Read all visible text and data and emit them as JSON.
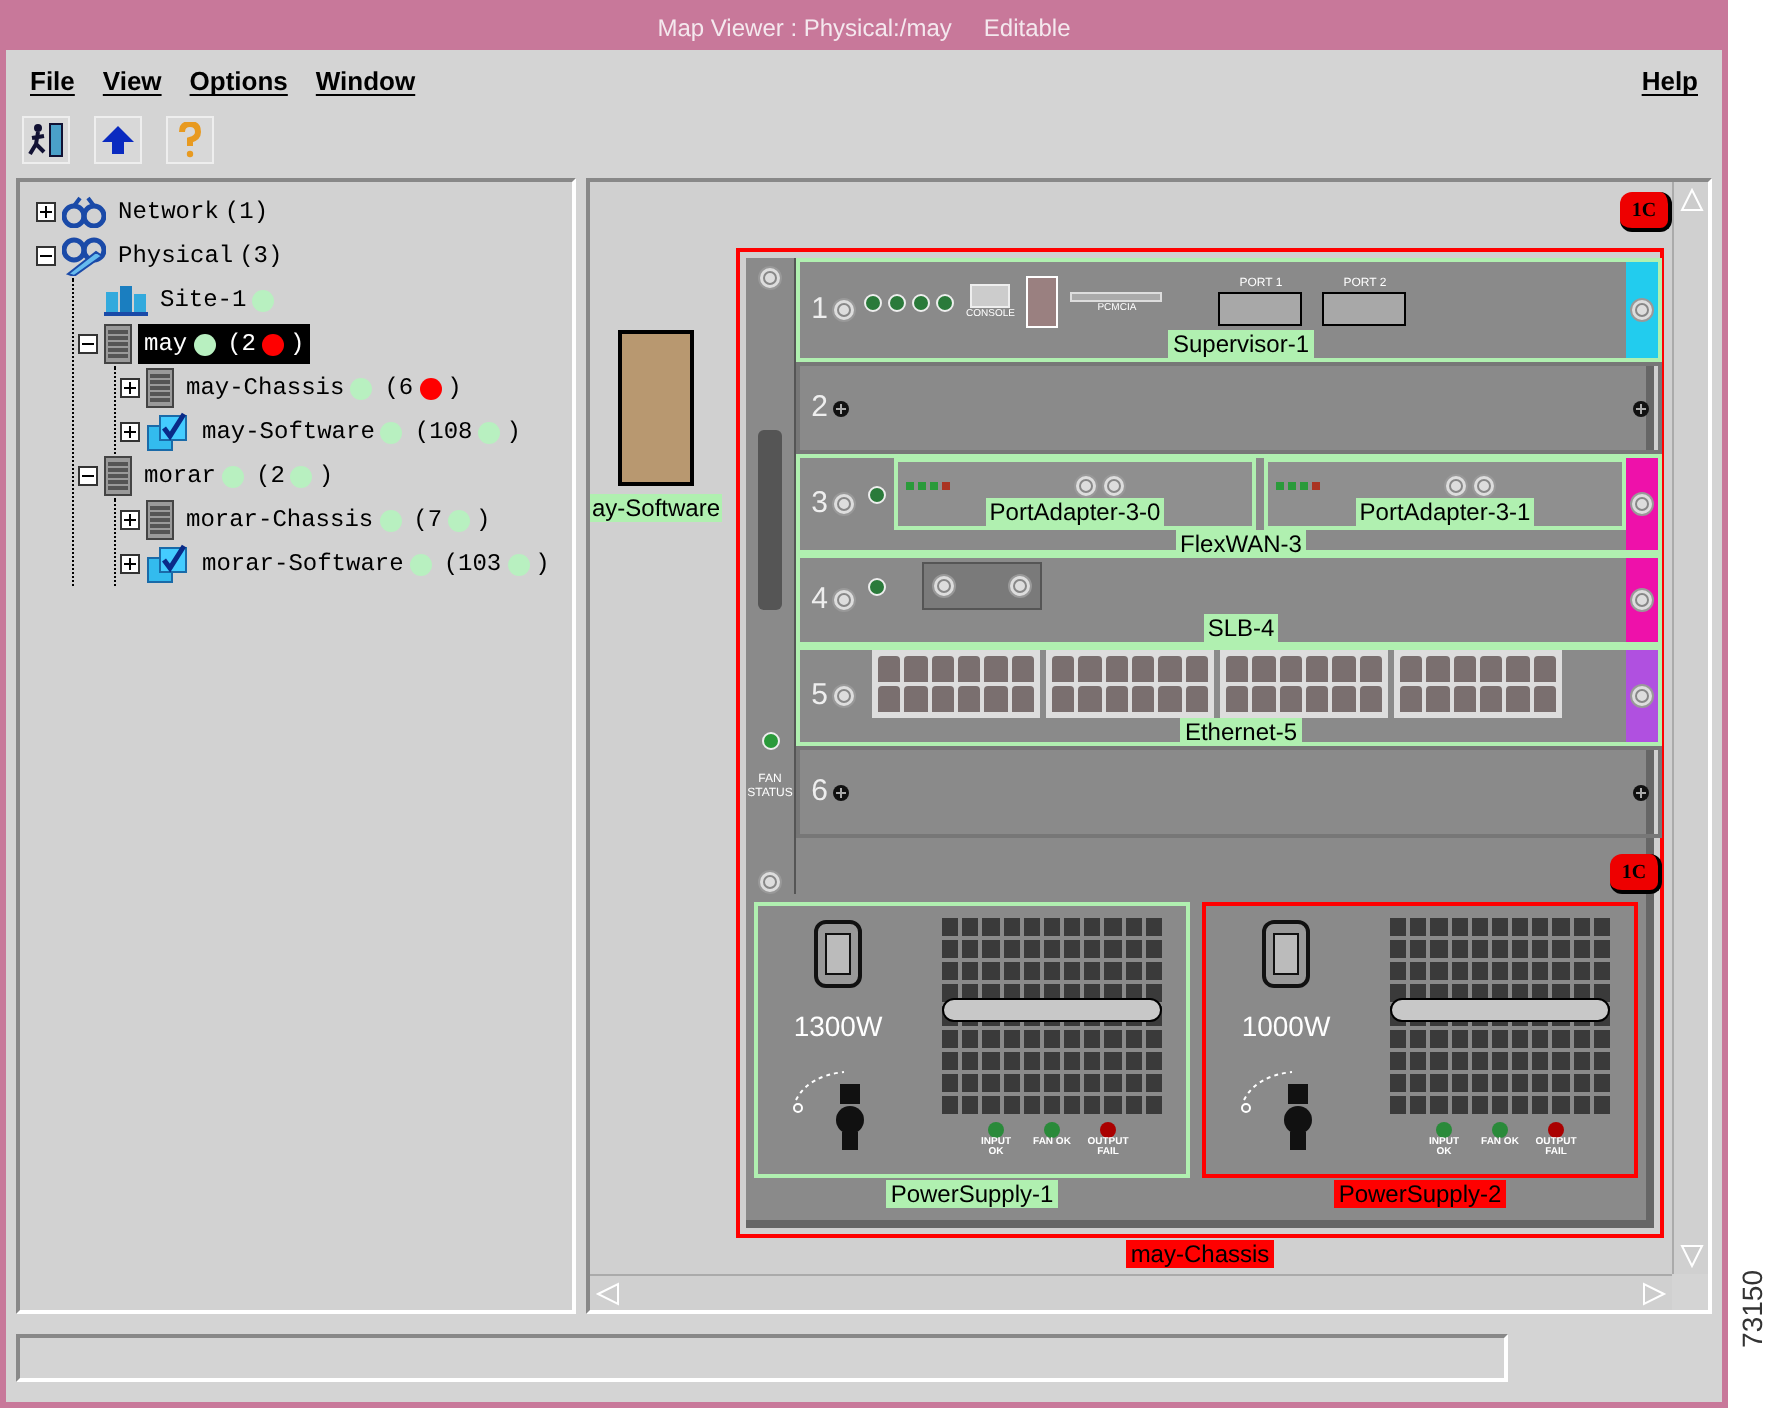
{
  "window": {
    "title": "Map Viewer : Physical:/may",
    "mode": "Editable"
  },
  "menu": [
    {
      "label": "File"
    },
    {
      "label": "View"
    },
    {
      "label": "Options"
    },
    {
      "label": "Window"
    }
  ],
  "help_menu": {
    "label": "Help"
  },
  "tree": [
    {
      "label": "Network",
      "count": {
        "text": "(1)"
      },
      "kind": "network",
      "expanded": false,
      "selected": false
    },
    {
      "label": "Physical",
      "count": {
        "text": "(3)"
      },
      "kind": "physical",
      "expanded": true,
      "selected": false,
      "children": [
        {
          "label": "Site-1",
          "kind": "site",
          "status": {
            "color": "#b8f0c0"
          },
          "selected": false
        },
        {
          "label": "may",
          "kind": "chassis",
          "expanded": true,
          "selected": true,
          "status": {
            "color": "#b8f0c0"
          },
          "count": {
            "text": "(2",
            "color": "#ff0000",
            "end": ")"
          },
          "children": [
            {
              "label": "may-Chassis",
              "kind": "chassis",
              "expanded": false,
              "selected": false,
              "status": {
                "color": "#b8f0c0"
              },
              "count": {
                "text": "(6",
                "color": "#ff0000",
                "end": ")"
              }
            },
            {
              "label": "may-Software",
              "kind": "software",
              "expanded": false,
              "selected": false,
              "status": {
                "color": "#b8f0c0"
              },
              "count": {
                "text": "(108",
                "color": "#b8f0c0",
                "end": ")"
              }
            }
          ]
        },
        {
          "label": "morar",
          "kind": "chassis",
          "expanded": true,
          "selected": false,
          "status": {
            "color": "#b8f0c0"
          },
          "count": {
            "text": "(2",
            "color": "#b8f0c0",
            "end": ")"
          },
          "children": [
            {
              "label": "morar-Chassis",
              "kind": "chassis",
              "expanded": false,
              "selected": false,
              "status": {
                "color": "#b8f0c0"
              },
              "count": {
                "text": "(7",
                "color": "#b8f0c0",
                "end": ")"
              }
            },
            {
              "label": "morar-Software",
              "kind": "software",
              "expanded": false,
              "selected": false,
              "status": {
                "color": "#b8f0c0"
              },
              "count": {
                "text": "(103",
                "color": "#b8f0c0",
                "end": ")"
              }
            }
          ]
        }
      ]
    }
  ],
  "map": {
    "software": {
      "label": "ay-Software"
    },
    "chassis": {
      "label": "may-Chassis",
      "color": "#ff0000",
      "alarm": "1C",
      "fan_status": "FAN STATUS",
      "slots": [
        {
          "number": "1",
          "kind": "supervisor",
          "label": "Supervisor-1",
          "color": "#b0f0b0",
          "strip": {
            "color": "#22ccee"
          },
          "console": "CONSOLE",
          "pcmcia": "PCMCIA",
          "ports": [
            "PORT 1",
            "PORT 2"
          ]
        },
        {
          "number": "2",
          "kind": "empty"
        },
        {
          "number": "3",
          "kind": "flexwan",
          "label": "FlexWAN-3",
          "color": "#b0f0b0",
          "strip": {
            "color": "#ee11aa"
          },
          "adapters": [
            {
              "label": "PortAdapter-3-0",
              "color": "#b0f0b0"
            },
            {
              "label": "PortAdapter-3-1",
              "color": "#b0f0b0"
            }
          ]
        },
        {
          "number": "4",
          "kind": "slb",
          "label": "SLB-4",
          "color": "#b0f0b0",
          "strip": {
            "color": "#ee11aa"
          }
        },
        {
          "number": "5",
          "kind": "ethernet",
          "label": "Ethernet-5",
          "color": "#b0f0b0",
          "strip": {
            "color": "#b050e0"
          }
        },
        {
          "number": "6",
          "kind": "empty"
        }
      ],
      "power_supplies": [
        {
          "label": "PowerSupply-1",
          "wattage": "1300W",
          "color": "#b0f0b0",
          "leds": [
            {
              "label": "INPUT OK",
              "color": "#2a8a3a"
            },
            {
              "label": "FAN OK",
              "color": "#2a8a3a"
            },
            {
              "label": "OUTPUT FAIL",
              "color": "#aa0000"
            }
          ]
        },
        {
          "label": "PowerSupply-2",
          "wattage": "1000W",
          "color": "#ff0000",
          "alarm": "1C",
          "leds": [
            {
              "label": "INPUT OK",
              "color": "#2a8a3a"
            },
            {
              "label": "FAN OK",
              "color": "#2a8a3a"
            },
            {
              "label": "OUTPUT FAIL",
              "color": "#aa0000"
            }
          ]
        }
      ]
    }
  },
  "figure_id": "73150"
}
